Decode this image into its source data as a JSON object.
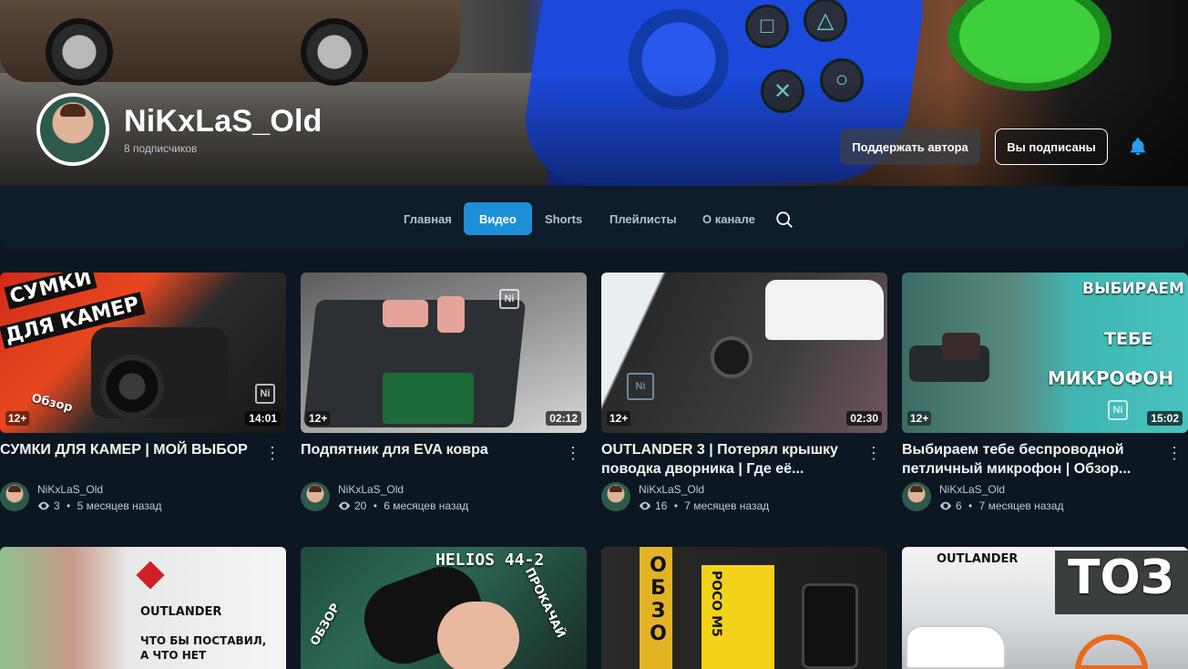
{
  "channel": {
    "name": "NiKxLaS_Old",
    "subscribers": "8 подписчиков",
    "support_label": "Поддержать автора",
    "subscribed_label": "Вы подписаны"
  },
  "tabs": [
    {
      "label": "Главная",
      "active": false
    },
    {
      "label": "Видео",
      "active": true
    },
    {
      "label": "Shorts",
      "active": false
    },
    {
      "label": "Плейлисты",
      "active": false
    },
    {
      "label": "О канале",
      "active": false
    }
  ],
  "colors": {
    "accent": "#1d8fd8",
    "bell": "#2b9cf0",
    "background": "#0c1722"
  },
  "icons": {
    "search": "search-icon",
    "bell": "bell-icon",
    "more": "more-vert-icon",
    "views": "eye-icon"
  },
  "videos": [
    {
      "title": "СУМКИ ДЛЯ КАМЕР | МОЙ ВЫБОР",
      "author": "NiKxLaS_Old",
      "views": "3",
      "age": "5 месяцев назад",
      "rating": "12+",
      "duration": "14:01",
      "thumb_text": [
        "СУМКИ",
        "ДЛЯ КАМЕР",
        "Обзор"
      ]
    },
    {
      "title": "Подпятник для EVA ковра",
      "author": "NiKxLaS_Old",
      "views": "20",
      "age": "6 месяцев назад",
      "rating": "12+",
      "duration": "02:12",
      "thumb_text": []
    },
    {
      "title": "OUTLANDER 3 | Потерял крышку поводка дворника | Где её...",
      "author": "NiKxLaS_Old",
      "views": "16",
      "age": "7 месяцев назад",
      "rating": "12+",
      "duration": "02:30",
      "thumb_text": []
    },
    {
      "title": "Выбираем тебе беспроводной петличный микрофон | Обзор...",
      "author": "NiKxLaS_Old",
      "views": "6",
      "age": "7 месяцев назад",
      "rating": "12+",
      "duration": "15:02",
      "thumb_text": [
        "ВЫБИРАЕМ",
        "ТЕБЕ",
        "МИКРОФОН"
      ]
    }
  ],
  "row2_thumbs": [
    {
      "thumb_text": [
        "OUTLANDER",
        "ЧТО БЫ ПОСТАВИЛ,",
        "А ЧТО НЕТ"
      ]
    },
    {
      "thumb_text": [
        "HELIOS 44-2",
        "ПРОКАЧАЙ",
        "ОБЗОР"
      ]
    },
    {
      "thumb_text": [
        "ОБЗО",
        "POCO M5"
      ]
    },
    {
      "thumb_text": [
        "OUTLANDER",
        "ТОЗ"
      ]
    }
  ]
}
